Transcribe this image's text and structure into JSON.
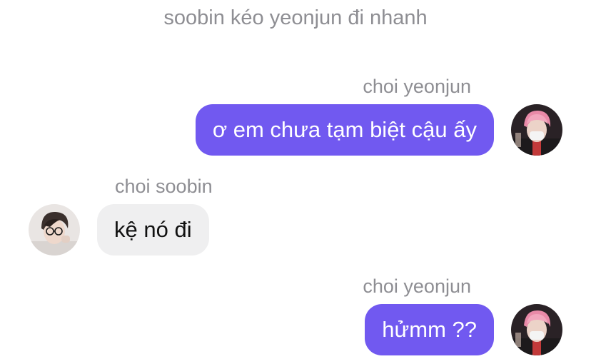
{
  "chat": {
    "system_message": "soobin kéo yeonjun đi nhanh",
    "messages": [
      {
        "sender": "choi yeonjun",
        "text": "ơ em chưa tạm biệt cậu ấy",
        "direction": "outgoing",
        "avatar": "pink-hair-avatar"
      },
      {
        "sender": "choi soobin",
        "text": "kệ nó đi",
        "direction": "incoming",
        "avatar": "glasses-avatar"
      },
      {
        "sender": "choi yeonjun",
        "text": "hửmm ??",
        "direction": "outgoing",
        "avatar": "pink-hair-avatar"
      }
    ]
  },
  "colors": {
    "outgoing_bubble": "#7159f0",
    "incoming_bubble": "#efeff0",
    "meta_text": "#8e8e93"
  }
}
